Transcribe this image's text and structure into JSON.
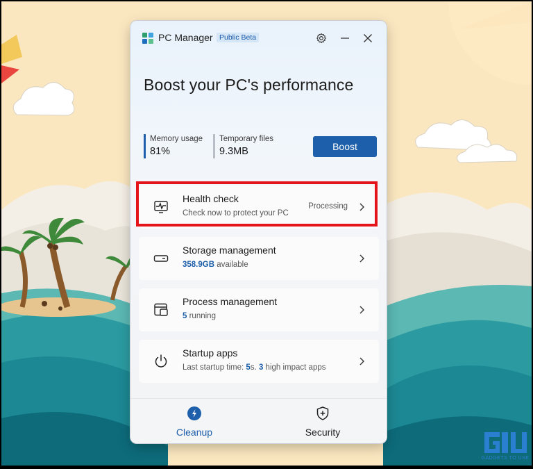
{
  "app": {
    "title": "PC Manager",
    "badge": "Public Beta"
  },
  "window_controls": {
    "settings_icon": "gear-icon",
    "minimize_icon": "minimize-icon",
    "close_icon": "close-icon"
  },
  "hero": {
    "title": "Boost your PC's performance"
  },
  "stats": {
    "memory": {
      "label": "Memory usage",
      "value": "81%",
      "accent": "#1d5faa"
    },
    "temp": {
      "label": "Temporary files",
      "value": "9.3MB",
      "accent": "#b9bec6"
    }
  },
  "boost_button": {
    "label": "Boost",
    "color": "#1d5faa"
  },
  "cards": {
    "health": {
      "title": "Health check",
      "subtitle": "Check now to protect your PC",
      "status": "Processing",
      "icon": "pulse-monitor-icon"
    },
    "storage": {
      "title": "Storage management",
      "value": "358.9GB",
      "suffix": " available",
      "icon": "storage-drive-icon"
    },
    "process": {
      "title": "Process management",
      "value": "5",
      "suffix": " running",
      "icon": "process-window-icon"
    },
    "startup": {
      "title": "Startup apps",
      "prefix": "Last startup time: ",
      "time_value": "5",
      "time_unit": "s. ",
      "impact_value": "3",
      "impact_suffix": " high impact apps",
      "icon": "power-icon"
    }
  },
  "nav": {
    "cleanup": {
      "label": "Cleanup",
      "active": true,
      "icon": "cleanup-icon",
      "color": "#1d5faa"
    },
    "security": {
      "label": "Security",
      "active": false,
      "icon": "shield-plus-icon"
    }
  },
  "highlight": {
    "color": "#e5141b"
  },
  "watermark": {
    "text": "GADGETS TO USE",
    "logo": "G1U"
  }
}
